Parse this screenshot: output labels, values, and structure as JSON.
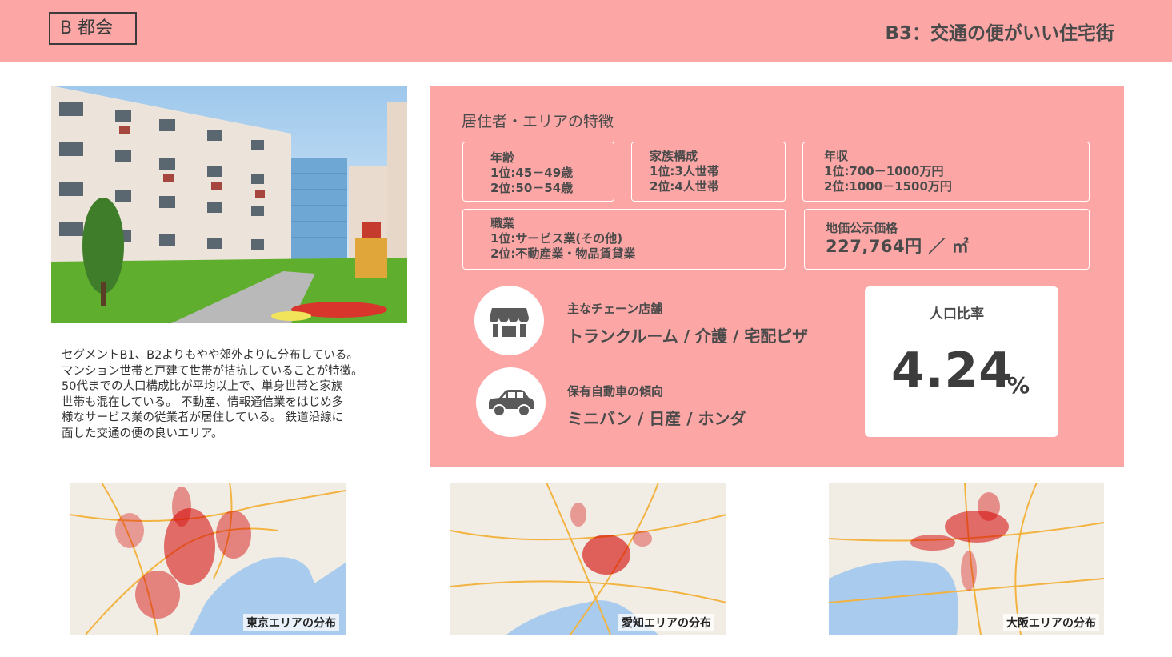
{
  "header": {
    "segment_label": "B 都会",
    "title": "B3：交通の便がいい住宅街"
  },
  "description": "セグメントB1、B2よりもやや郊外よりに分布している。\nマンション世帯と戸建て世帯が拮抗していることが特徴。\n50代までの人口構成比が平均以上で、単身世帯と家族\n世帯も混在している。 不動産、情報通信業をはじめ多\n様なサービス業の従業者が居住している。 鉄道沿線に\n面した交通の便の良いエリア。",
  "panel": {
    "title": "居住者・エリアの特徴",
    "age": {
      "label": "年齢",
      "line1": "1位:45－49歳",
      "line2": "2位:50－54歳"
    },
    "family": {
      "label": "家族構成",
      "line1": "1位:3人世帯",
      "line2": "2位:4人世帯"
    },
    "income": {
      "label": "年収",
      "line1": "1位:700－1000万円",
      "line2": "2位:1000－1500万円"
    },
    "job": {
      "label": "職業",
      "line1": "1位:サービス業(その他)",
      "line2": "2位:不動産業・物品賃貸業"
    },
    "land": {
      "label": "地価公示価格",
      "value": "227,764円 ／ ㎡"
    },
    "chain": {
      "label": "主なチェーン店舗",
      "value": "トランクルーム / 介護 / 宅配ピザ"
    },
    "car": {
      "label": "保有自動車の傾向",
      "value": "ミニバン / 日産  / ホンダ"
    },
    "ratio": {
      "label": "人口比率",
      "value": "4.24",
      "unit": "%"
    }
  },
  "icons": {
    "shop": "store-icon",
    "car": "car-icon"
  },
  "colors": {
    "accent": "#fca6a6",
    "text": "#3c3c3c",
    "dots": "#d40000"
  },
  "maps": [
    {
      "caption": "東京エリアの分布"
    },
    {
      "caption": "愛知エリアの分布"
    },
    {
      "caption": "大阪エリアの分布"
    }
  ]
}
